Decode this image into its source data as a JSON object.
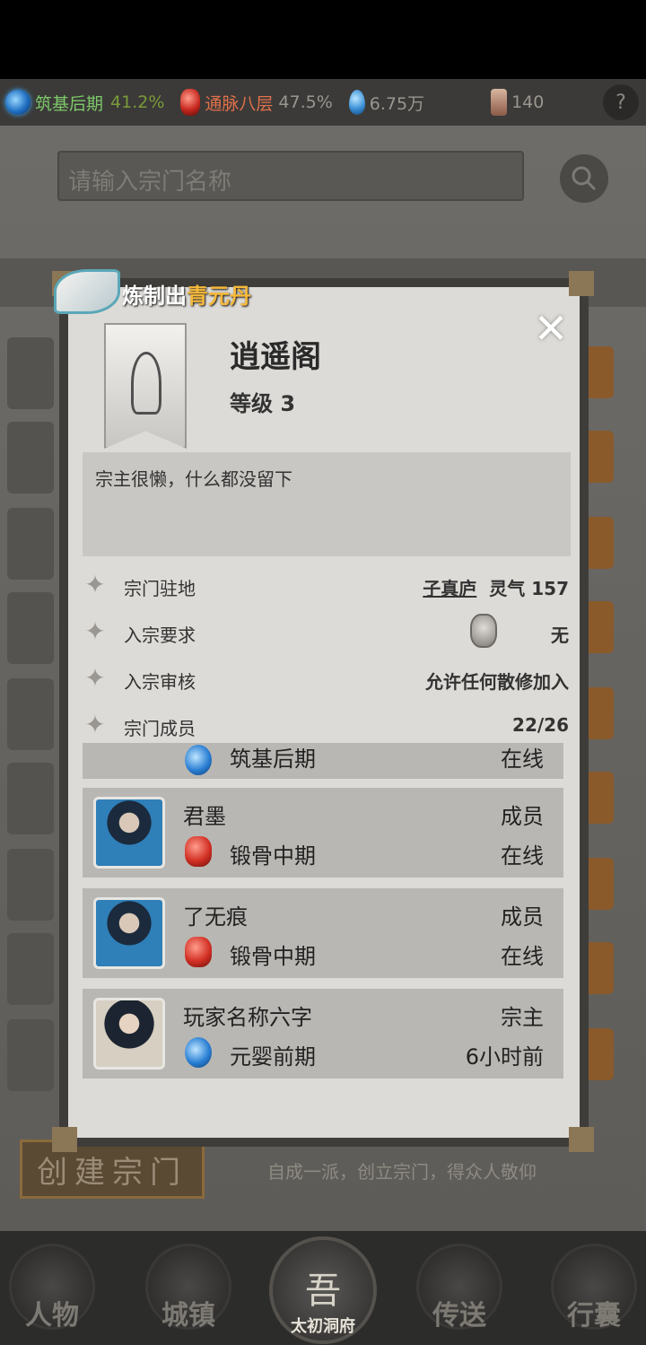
{
  "status": {
    "cultivation": {
      "icon": "blue-orb-icon",
      "label": "筑基后期",
      "percent": "41.2%",
      "label_color": "#7ec86a",
      "percent_color": "#7a9a3a"
    },
    "meridian": {
      "icon": "red-gem-icon",
      "label": "通脉八层",
      "percent": "47.5%",
      "label_color": "#e0704a",
      "percent_color": "#9a9690"
    },
    "spirit_stones": {
      "icon": "blue-drop-icon",
      "value": "6.75万"
    },
    "scrolls": {
      "icon": "scroll-icon",
      "value": "140"
    },
    "help": "?"
  },
  "background": {
    "search_placeholder": "请输入宗门名称",
    "create_button": "创建宗门",
    "create_desc": "自成一派，创立宗门，得众人敬仰"
  },
  "toast": {
    "prefix": "炼制出",
    "highlight": "青元丹"
  },
  "sect": {
    "name": "逍遥阁",
    "level": "等级 3",
    "close": "✕",
    "motto": "宗主很懒，什么都没留下",
    "info": [
      {
        "label": "宗门驻地",
        "location": "子真庐",
        "value": "灵气 157"
      },
      {
        "label": "入宗要求",
        "value": "无"
      },
      {
        "label": "入宗审核",
        "value": "允许任何散修加入"
      },
      {
        "label": "宗门成员",
        "value": "22/26"
      }
    ],
    "members": [
      {
        "name": "",
        "role": "",
        "realm": "筑基后期",
        "status": "在线",
        "realm_type": "blue"
      },
      {
        "name": "君墨",
        "role": "成员",
        "realm": "锻骨中期",
        "status": "在线",
        "realm_type": "red"
      },
      {
        "name": "了无痕",
        "role": "成员",
        "realm": "锻骨中期",
        "status": "在线",
        "realm_type": "red"
      },
      {
        "name": "玩家名称六字",
        "role": "宗主",
        "realm": "元婴前期",
        "status": "6小时前",
        "realm_type": "blue"
      }
    ]
  },
  "nav": {
    "items": [
      "人物",
      "城镇",
      "传送",
      "行囊"
    ],
    "center_glyph": "吾",
    "center_label": "太初洞府"
  }
}
